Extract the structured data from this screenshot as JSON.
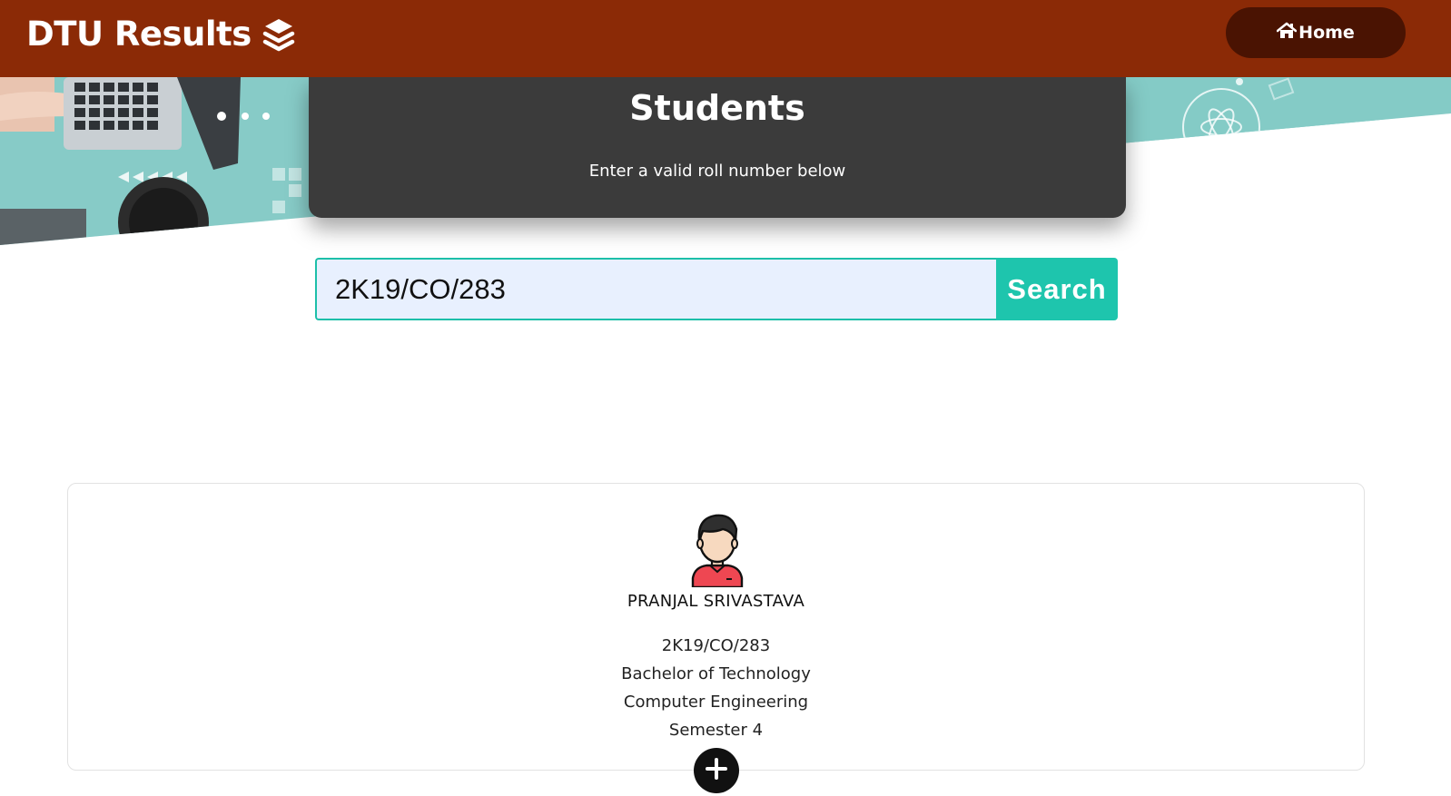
{
  "navbar": {
    "brand": "DTU Results",
    "brand_icon": "layers-icon",
    "home_label": "Home",
    "home_icon": "home-icon",
    "color": "#8b2a06",
    "home_button_color": "#4a1302"
  },
  "banner": {
    "title": "Students",
    "subtitle": "Enter a valid roll number below"
  },
  "search": {
    "value": "2K19/CO/283",
    "button_label": "Search",
    "accent": "#1ec5ad"
  },
  "student": {
    "name": "PRANJAL SRIVASTAVA",
    "roll": "2K19/CO/283",
    "degree": "Bachelor of Technology",
    "branch": "Computer Engineering",
    "semester": "Semester 4",
    "avatar_icon": "student-avatar-icon",
    "expand_icon": "plus-icon"
  }
}
